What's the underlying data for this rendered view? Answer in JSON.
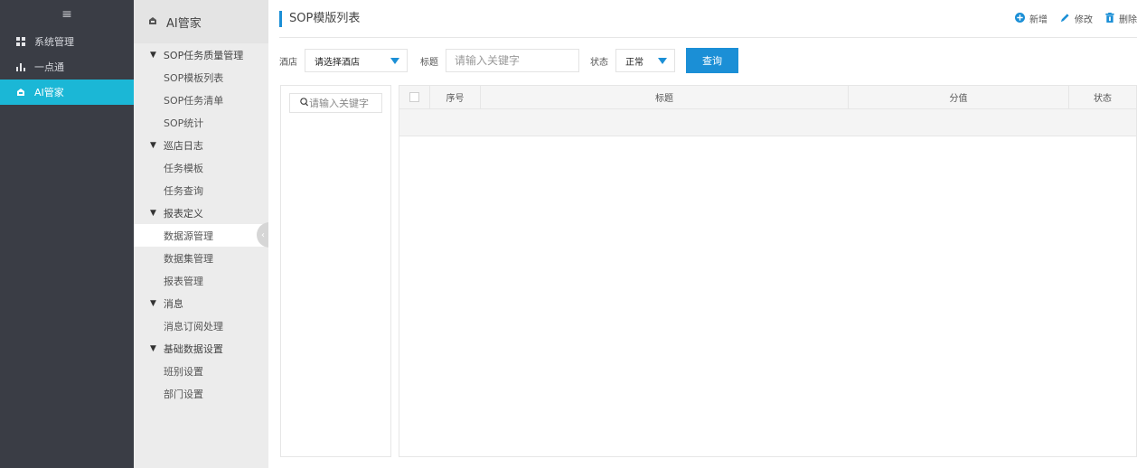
{
  "nav": {
    "menu_glyph": "≡",
    "items": [
      {
        "icon": "grid-icon",
        "label": "系统管理"
      },
      {
        "icon": "bar-chart-icon",
        "label": "一点通"
      },
      {
        "icon": "ai-icon",
        "label": "AI管家"
      }
    ],
    "active_index": 2
  },
  "sub": {
    "header": "AI管家",
    "groups": [
      {
        "label": "SOP任务质量管理",
        "items": [
          "SOP模板列表",
          "SOP任务清单",
          "SOP统计"
        ]
      },
      {
        "label": "巡店日志",
        "items": [
          "任务模板",
          "任务查询"
        ]
      },
      {
        "label": "报表定义",
        "items": [
          "数据源管理",
          "数据集管理",
          "报表管理"
        ]
      },
      {
        "label": "消息",
        "items": [
          "消息订阅处理"
        ]
      },
      {
        "label": "基础数据设置",
        "items": [
          "班别设置",
          "部门设置"
        ]
      }
    ],
    "selected": "数据源管理"
  },
  "main": {
    "title": "SOP模版列表",
    "actions": [
      {
        "icon": "plus-circle-icon",
        "label": "新增"
      },
      {
        "icon": "pencil-icon",
        "label": "修改"
      },
      {
        "icon": "trash-icon",
        "label": "删除"
      }
    ],
    "filters": {
      "hotel_label": "酒店",
      "hotel_value": "请选择酒店",
      "title_label": "标题",
      "title_placeholder": "请输入关键字",
      "status_label": "状态",
      "status_value": "正常",
      "query_button": "查询"
    },
    "tree_search_placeholder": "请输入关键字",
    "table": {
      "columns": [
        "序号",
        "标题",
        "分值",
        "状态"
      ]
    }
  },
  "colors": {
    "accent": "#1b8fd6",
    "nav_bg": "#3a3d45",
    "nav_active": "#1bb7d6"
  }
}
